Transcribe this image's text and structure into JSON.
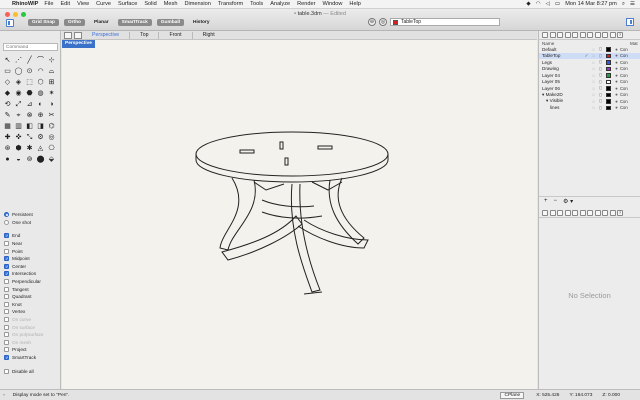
{
  "menubar": {
    "app_name": "RhinoWIP",
    "items": [
      "File",
      "Edit",
      "View",
      "Curve",
      "Surface",
      "Solid",
      "Mesh",
      "Dimension",
      "Transform",
      "Tools",
      "Analyze",
      "Render",
      "Window",
      "Help"
    ],
    "clock": "Mon 14 Mar  8:27 pm"
  },
  "titlebar": {
    "doc_name": "table.3dm",
    "doc_status": "— Edited"
  },
  "toolbar": {
    "buttons": [
      "Grid Snap",
      "Ortho",
      "Planar",
      "SmartTrack",
      "Gumball",
      "History"
    ],
    "current_layer": "TableTop",
    "current_layer_color": "#d42020"
  },
  "command": {
    "placeholder": "Command"
  },
  "tools": [
    "↖",
    "⋰",
    "╱",
    "⌒",
    "⊹",
    "▭",
    "◯",
    "⊙",
    "◠",
    "⌓",
    "◇",
    "◈",
    "⬚",
    "⬡",
    "⊞",
    "◆",
    "◉",
    "⬣",
    "◍",
    "✶",
    "⟲",
    "⤢",
    "⊿",
    "◐",
    "◑",
    "✎",
    "⌖",
    "⊗",
    "⊕",
    "✂",
    "▦",
    "▥",
    "◧",
    "◨",
    "⌬",
    "✚",
    "✜",
    "⤡",
    "⚙",
    "◎",
    "⊛",
    "⬢",
    "✱",
    "◬",
    "⎔",
    "●",
    "◒",
    "⊚",
    "⬤",
    "⬙"
  ],
  "osnap": {
    "persistent": "Persistent",
    "one_shot": "One shot",
    "items": [
      {
        "label": "End",
        "checked": true,
        "disabled": false
      },
      {
        "label": "Near",
        "checked": false,
        "disabled": false
      },
      {
        "label": "Point",
        "checked": false,
        "disabled": false
      },
      {
        "label": "Midpoint",
        "checked": true,
        "disabled": false
      },
      {
        "label": "Center",
        "checked": true,
        "disabled": false
      },
      {
        "label": "Intersection",
        "checked": true,
        "disabled": false
      },
      {
        "label": "Perpendicular",
        "checked": false,
        "disabled": false
      },
      {
        "label": "Tangent",
        "checked": false,
        "disabled": false
      },
      {
        "label": "Quadrant",
        "checked": false,
        "disabled": false
      },
      {
        "label": "Knot",
        "checked": false,
        "disabled": false
      },
      {
        "label": "Vertex",
        "checked": false,
        "disabled": false
      },
      {
        "label": "On curve",
        "checked": false,
        "disabled": true
      },
      {
        "label": "On surface",
        "checked": false,
        "disabled": true
      },
      {
        "label": "On polysurface",
        "checked": false,
        "disabled": true
      },
      {
        "label": "On mesh",
        "checked": false,
        "disabled": true
      },
      {
        "label": "Project",
        "checked": false,
        "disabled": false
      },
      {
        "label": "SmartTrack",
        "checked": true,
        "disabled": false
      }
    ],
    "disable_all": "Disable all"
  },
  "viewport": {
    "tabs": [
      "Perspective",
      "Top",
      "Front",
      "Right"
    ],
    "active_tab": "Perspective",
    "label": "Perspective"
  },
  "layers": {
    "header_name": "Name",
    "header_material": "Mat",
    "rows": [
      {
        "name": "Default",
        "color": "#000000",
        "material": "Con",
        "indent": 0
      },
      {
        "name": "TableTop",
        "color": "#d42020",
        "material": "Con",
        "indent": 0
      },
      {
        "name": "Legs",
        "color": "#3a55d8",
        "material": "Con",
        "indent": 0
      },
      {
        "name": "Drawing",
        "color": "#a030c8",
        "material": "Con",
        "indent": 0
      },
      {
        "name": "Layer 04",
        "color": "#20a040",
        "material": "Con",
        "indent": 0
      },
      {
        "name": "Layer 05",
        "color": "#ffffff",
        "material": "Con",
        "indent": 0
      },
      {
        "name": "Layer 06",
        "color": "#000000",
        "material": "Con",
        "indent": 0
      },
      {
        "name": "▾ Make2D",
        "color": "#000000",
        "material": "Con",
        "indent": 0
      },
      {
        "name": "▾ Visible",
        "color": "#000000",
        "material": "Con",
        "indent": 4
      },
      {
        "name": "lines",
        "color": "#000000",
        "material": "Con",
        "indent": 8
      }
    ]
  },
  "properties": {
    "empty_text": "No Selection"
  },
  "statusbar": {
    "message": "Display mode set to \"Pen\".",
    "cplane": "CPlane",
    "x": "X: 525.426",
    "y": "Y: 164.073",
    "z": "Z: 0.000"
  }
}
